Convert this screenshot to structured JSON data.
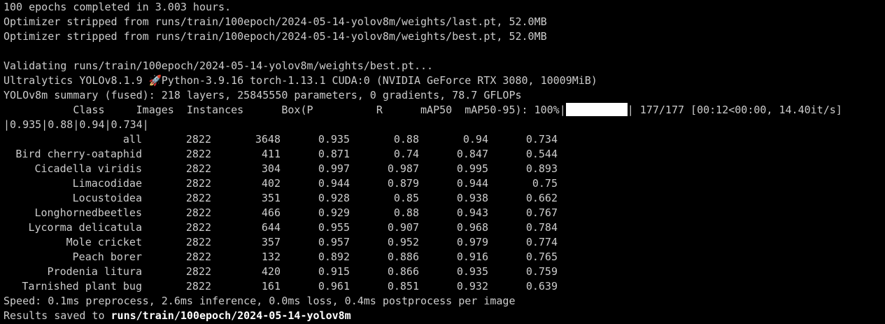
{
  "log": {
    "epochs_line": "100 epochs completed in 3.003 hours.",
    "strip_last": "Optimizer stripped from runs/train/100epoch/2024-05-14-yolov8m/weights/last.pt, 52.0MB",
    "strip_best": "Optimizer stripped from runs/train/100epoch/2024-05-14-yolov8m/weights/best.pt, 52.0MB",
    "validating": "Validating runs/train/100epoch/2024-05-14-yolov8m/weights/best.pt...",
    "ultra_prefix": "Ultralytics YOLOv8.1.9 ",
    "ultra_rocket": "🚀",
    "ultra_suffix": "Python-3.9.16 torch-1.13.1 CUDA:0 (NVIDIA GeForce RTX 3080, 10009MiB)",
    "summary": "YOLOv8m summary (fused): 218 layers, 25845550 parameters, 0 gradients, 78.7 GFLOPs",
    "header_cols": "           Class     Images  Instances      Box(P          R      mAP50  mAP50-95): 100%|",
    "progress_percent": 1.0,
    "progress_tail": "| 177/177 [00:12<00:00, 14.40it/s]",
    "wrap_line": "|0.935|0.88|0.94|0.734|",
    "speed": "Speed: 0.1ms preprocess, 2.6ms inference, 0.0ms loss, 0.4ms postprocess per image",
    "results_prefix": "Results saved to ",
    "results_path": "runs/train/100epoch/2024-05-14-yolov8m"
  },
  "table": {
    "rows": [
      {
        "class": "all",
        "images": "2822",
        "instances": "3648",
        "p": "0.935",
        "r": "0.88",
        "map50": "0.94",
        "map50_95": "0.734"
      },
      {
        "class": "Bird cherry-oataphid",
        "images": "2822",
        "instances": "411",
        "p": "0.871",
        "r": "0.74",
        "map50": "0.847",
        "map50_95": "0.544"
      },
      {
        "class": "Cicadella viridis",
        "images": "2822",
        "instances": "304",
        "p": "0.997",
        "r": "0.987",
        "map50": "0.995",
        "map50_95": "0.893"
      },
      {
        "class": "Limacodidae",
        "images": "2822",
        "instances": "402",
        "p": "0.944",
        "r": "0.879",
        "map50": "0.944",
        "map50_95": "0.75"
      },
      {
        "class": "Locustoidea",
        "images": "2822",
        "instances": "351",
        "p": "0.928",
        "r": "0.85",
        "map50": "0.938",
        "map50_95": "0.662"
      },
      {
        "class": "Longhornedbeetles",
        "images": "2822",
        "instances": "466",
        "p": "0.929",
        "r": "0.88",
        "map50": "0.943",
        "map50_95": "0.767"
      },
      {
        "class": "Lycorma delicatula",
        "images": "2822",
        "instances": "644",
        "p": "0.955",
        "r": "0.907",
        "map50": "0.968",
        "map50_95": "0.784"
      },
      {
        "class": "Mole cricket",
        "images": "2822",
        "instances": "357",
        "p": "0.957",
        "r": "0.952",
        "map50": "0.979",
        "map50_95": "0.774"
      },
      {
        "class": "Peach borer",
        "images": "2822",
        "instances": "132",
        "p": "0.892",
        "r": "0.886",
        "map50": "0.916",
        "map50_95": "0.765"
      },
      {
        "class": "Prodenia litura",
        "images": "2822",
        "instances": "420",
        "p": "0.915",
        "r": "0.866",
        "map50": "0.935",
        "map50_95": "0.759"
      },
      {
        "class": "Tarnished plant bug",
        "images": "2822",
        "instances": "161",
        "p": "0.961",
        "r": "0.851",
        "map50": "0.932",
        "map50_95": "0.639"
      }
    ]
  }
}
